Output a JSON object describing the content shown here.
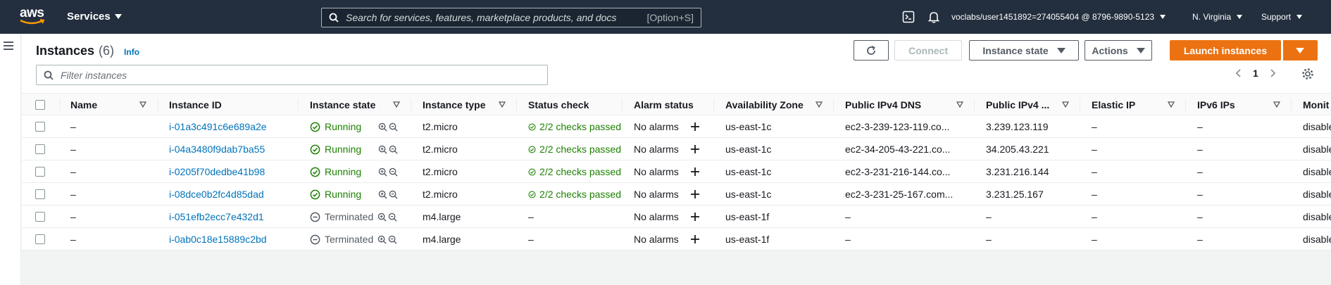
{
  "nav": {
    "logo": "aws",
    "services": "Services",
    "search_placeholder": "Search for services, features, marketplace products, and docs",
    "search_shortcut": "[Option+S]",
    "account": "voclabs/user1451892=274055404 @ 8796-9890-5123",
    "region": "N. Virginia",
    "support": "Support"
  },
  "header": {
    "title": "Instances",
    "count": "(6)",
    "info": "Info",
    "filter_placeholder": "Filter instances",
    "page": "1"
  },
  "toolbar": {
    "connect": "Connect",
    "instance_state": "Instance state",
    "actions": "Actions",
    "launch": "Launch instances"
  },
  "columns": [
    "Name",
    "Instance ID",
    "Instance state",
    "Instance type",
    "Status check",
    "Alarm status",
    "Availability Zone",
    "Public IPv4 DNS",
    "Public IPv4 ...",
    "Elastic IP",
    "IPv6 IPs",
    "Monit"
  ],
  "rows": [
    {
      "name": "–",
      "id": "i-01a3c491c6e689a2e",
      "state": "Running",
      "type": "t2.micro",
      "status": "2/2 checks passed",
      "alarm": "No alarms",
      "az": "us-east-1c",
      "dns": "ec2-3-239-123-119.co...",
      "ip": "3.239.123.119",
      "eip": "–",
      "ipv6": "–",
      "monit": "disable"
    },
    {
      "name": "–",
      "id": "i-04a3480f9dab7ba55",
      "state": "Running",
      "type": "t2.micro",
      "status": "2/2 checks passed",
      "alarm": "No alarms",
      "az": "us-east-1c",
      "dns": "ec2-34-205-43-221.co...",
      "ip": "34.205.43.221",
      "eip": "–",
      "ipv6": "–",
      "monit": "disable"
    },
    {
      "name": "–",
      "id": "i-0205f70dedbe41b98",
      "state": "Running",
      "type": "t2.micro",
      "status": "2/2 checks passed",
      "alarm": "No alarms",
      "az": "us-east-1c",
      "dns": "ec2-3-231-216-144.co...",
      "ip": "3.231.216.144",
      "eip": "–",
      "ipv6": "–",
      "monit": "disable"
    },
    {
      "name": "–",
      "id": "i-08dce0b2fc4d85dad",
      "state": "Running",
      "type": "t2.micro",
      "status": "2/2 checks passed",
      "alarm": "No alarms",
      "az": "us-east-1c",
      "dns": "ec2-3-231-25-167.com...",
      "ip": "3.231.25.167",
      "eip": "–",
      "ipv6": "–",
      "monit": "disable"
    },
    {
      "name": "–",
      "id": "i-051efb2ecc7e432d1",
      "state": "Terminated",
      "type": "m4.large",
      "status": "–",
      "alarm": "No alarms",
      "az": "us-east-1f",
      "dns": "–",
      "ip": "–",
      "eip": "–",
      "ipv6": "–",
      "monit": "disable"
    },
    {
      "name": "–",
      "id": "i-0ab0c18e15889c2bd",
      "state": "Terminated",
      "type": "m4.large",
      "status": "–",
      "alarm": "No alarms",
      "az": "us-east-1f",
      "dns": "–",
      "ip": "–",
      "eip": "–",
      "ipv6": "–",
      "monit": "disable"
    }
  ],
  "colors": {
    "nav_bg": "#232f3e",
    "link": "#0073bb",
    "success": "#1d8102",
    "primary_button": "#ec7211"
  }
}
